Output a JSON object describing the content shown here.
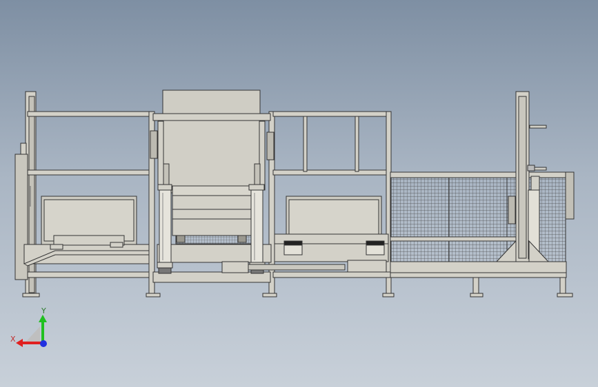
{
  "viewport": {
    "background_top": "#7e8fa3",
    "background_bottom": "#c8d0d9",
    "model_fill": "#d3d1c8",
    "model_stroke": "#333333",
    "mesh_stroke": "#555555"
  },
  "triad": {
    "x_label": "X",
    "y_label": "Y",
    "x_color": "#e02020",
    "y_color": "#20c020",
    "z_color": "#2030e0"
  }
}
